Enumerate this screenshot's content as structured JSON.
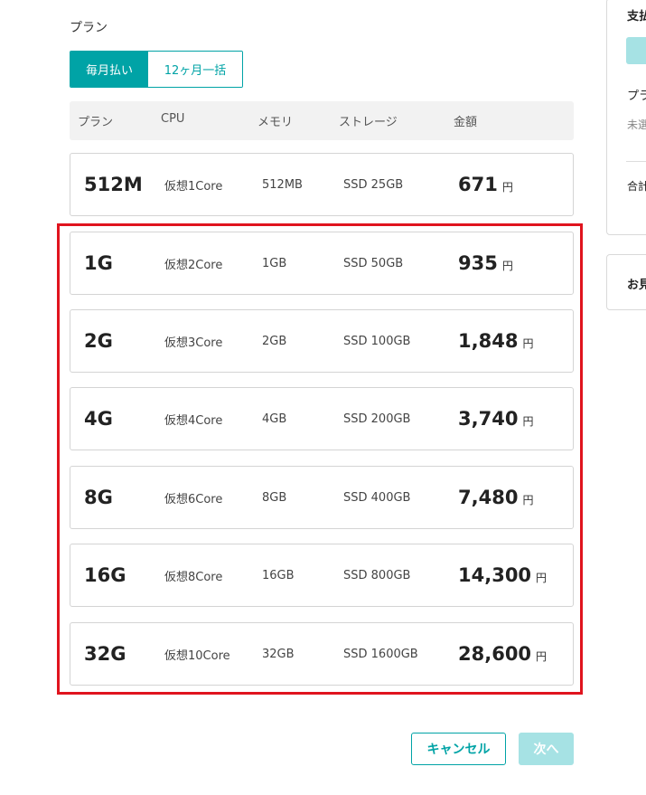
{
  "section_title": "プラン",
  "billing": {
    "monthly": "毎月払い",
    "yearly": "12ヶ月一括"
  },
  "table_header": {
    "plan": "プラン",
    "cpu": "CPU",
    "memory": "メモリ",
    "storage": "ストレージ",
    "price": "金額"
  },
  "currency_label": "円",
  "plans": [
    {
      "name": "512M",
      "cpu": "仮想1Core",
      "memory": "512MB",
      "storage": "SSD 25GB",
      "price": "671"
    },
    {
      "name": "1G",
      "cpu": "仮想2Core",
      "memory": "1GB",
      "storage": "SSD 50GB",
      "price": "935"
    },
    {
      "name": "2G",
      "cpu": "仮想3Core",
      "memory": "2GB",
      "storage": "SSD 100GB",
      "price": "1,848"
    },
    {
      "name": "4G",
      "cpu": "仮想4Core",
      "memory": "4GB",
      "storage": "SSD 200GB",
      "price": "3,740"
    },
    {
      "name": "8G",
      "cpu": "仮想6Core",
      "memory": "8GB",
      "storage": "SSD 400GB",
      "price": "7,480"
    },
    {
      "name": "16G",
      "cpu": "仮想8Core",
      "memory": "16GB",
      "storage": "SSD 800GB",
      "price": "14,300"
    },
    {
      "name": "32G",
      "cpu": "仮想10Core",
      "memory": "32GB",
      "storage": "SSD 1600GB",
      "price": "28,600"
    }
  ],
  "buttons": {
    "cancel": "キャンセル",
    "next": "次へ"
  },
  "side_panel": {
    "payment_partial": "支払",
    "plan_partial": "プラ",
    "unselected_partial": "未選",
    "total_partial": "合計",
    "estimate_partial": "お見"
  },
  "colors": {
    "accent": "#00a3a6",
    "accent_disabled": "#a6e2e4",
    "highlight": "#e0141e"
  }
}
